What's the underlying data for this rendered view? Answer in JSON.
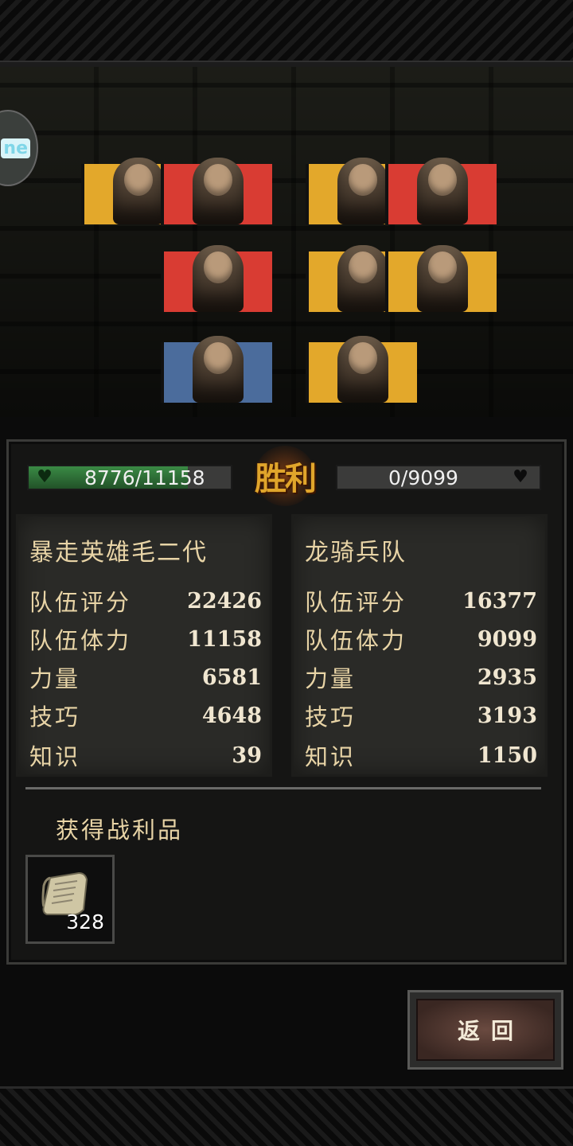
{
  "battle": {
    "result": "胜利"
  },
  "side_app": {
    "label": "ne"
  },
  "left_team": {
    "hp_text": "8776/11158",
    "hp_fraction": 0.787,
    "name": "暴走英雄毛二代",
    "stats": [
      {
        "label": "队伍评分",
        "value": "22426"
      },
      {
        "label": "队伍体力",
        "value": "11158"
      },
      {
        "label": "力量",
        "value": "6581"
      },
      {
        "label": "技巧",
        "value": "4648"
      },
      {
        "label": "知识",
        "value": "39"
      }
    ]
  },
  "right_team": {
    "hp_text": "0/9099",
    "hp_fraction": 0,
    "name": "龙骑兵队",
    "stats": [
      {
        "label": "队伍评分",
        "value": "16377"
      },
      {
        "label": "队伍体力",
        "value": "9099"
      },
      {
        "label": "力量",
        "value": "2935"
      },
      {
        "label": "技巧",
        "value": "3193"
      },
      {
        "label": "知识",
        "value": "1150"
      }
    ]
  },
  "loot": {
    "title": "获得战利品",
    "items": [
      {
        "icon": "scroll-icon",
        "count": "328"
      }
    ]
  },
  "back_button": {
    "label": "返回"
  },
  "colors": {
    "card_yellow": "#e3a82b",
    "card_red": "#d93c33",
    "card_blue": "#4b6c9c",
    "hp_green": "#2f6e36",
    "victory_gold": "#e0a52b"
  }
}
